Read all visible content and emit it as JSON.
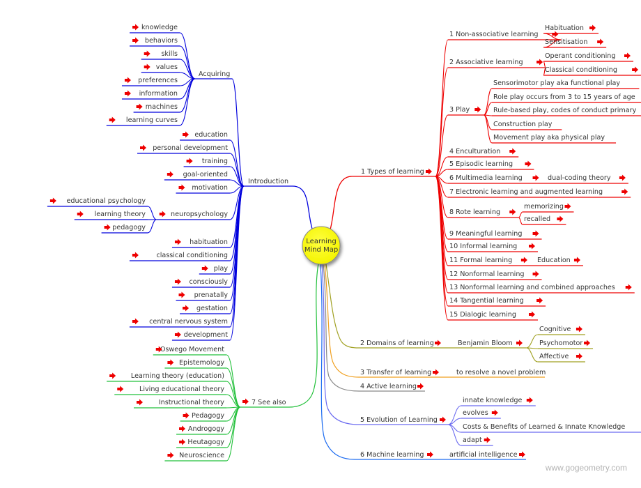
{
  "title": "Learning Mind Map",
  "root": {
    "label_lines": [
      "Learning",
      "Mind Map"
    ],
    "fill": "#ffff00"
  },
  "watermark": "www.gogeometry.com",
  "colors": {
    "introduction": "#0000dd",
    "see_also": "#22c03a",
    "types": "#ee0000",
    "domains": "#a0a020",
    "transfer": "#f0a020",
    "active": "#888888",
    "evolution": "#6a6af0",
    "machine": "#1a6af0",
    "link_arrow": "#ee0000"
  },
  "left": {
    "introduction": {
      "label": "Introduction",
      "acquiring": {
        "label": "Acquiring",
        "items": [
          "knowledge",
          "behaviors",
          "skills",
          "values",
          "preferences",
          "information",
          "machines",
          "learning curves"
        ]
      },
      "items": [
        "education",
        "personal development",
        "training",
        "goal-oriented",
        "motivation"
      ],
      "neuropsychology": {
        "label": "neuropsychology",
        "items": [
          "educational psychology",
          "learning theory",
          "pedagogy"
        ]
      },
      "items_after": [
        "habituation",
        "classical conditioning",
        "play",
        "consciously",
        "prenatally",
        "gestation",
        "central nervous system",
        "development"
      ]
    },
    "see_also": {
      "label": "7 See also",
      "items": [
        "Oswego Movement",
        "Epistemology",
        "Learning theory (education)",
        "Living educational theory",
        "Instructional theory",
        "Pedagogy",
        "Androgogy",
        "Heutagogy",
        "Neuroscience"
      ]
    }
  },
  "right": {
    "types": {
      "label": "1 Types of learning",
      "items": [
        {
          "label": "1 Non-associative learning",
          "children": [
            "Habituation",
            "Sensitisation"
          ]
        },
        {
          "label": "2 Associative learning",
          "children": [
            "Operant conditioning",
            "Classical conditioning"
          ]
        },
        {
          "label": "3 Play",
          "children": [
            "Sensorimotor play aka functional play",
            "Role play occurs from 3 to 15 years of age",
            "Rule-based play, codes of conduct primary",
            "Construction play",
            "Movement play aka physical play"
          ]
        },
        {
          "label": "4 Enculturation"
        },
        {
          "label": "5 Episodic learning"
        },
        {
          "label": "6 Multimedia learning",
          "inline": "dual-coding theory"
        },
        {
          "label": "7 Electronic learning and augmented learning"
        },
        {
          "label": "8 Rote learning",
          "children": [
            "memorizing",
            "recalled"
          ]
        },
        {
          "label": "9 Meaningful learning"
        },
        {
          "label": "10 Informal learning"
        },
        {
          "label": "11 Formal learning",
          "inline": "Education"
        },
        {
          "label": "12 Nonformal learning"
        },
        {
          "label": "13 Nonformal learning and combined approaches"
        },
        {
          "label": "14 Tangential learning"
        },
        {
          "label": "15 Dialogic learning"
        }
      ]
    },
    "domains": {
      "label": "2 Domains of learning",
      "inline": "Benjamin Bloom",
      "children": [
        "Cognitive",
        "Psychomotor",
        "Affective"
      ]
    },
    "transfer": {
      "label": "3 Transfer of learning",
      "inline": "to resolve a novel problem"
    },
    "active": {
      "label": "4 Active learning"
    },
    "evolution": {
      "label": "5 Evolution of Learning",
      "children": [
        "innate knowledge",
        "evolves",
        "Costs & Benefits of Learned & Innate Knowledge",
        "adapt"
      ]
    },
    "machine": {
      "label": "6 Machine learning",
      "inline": "artificial intelligence"
    }
  }
}
